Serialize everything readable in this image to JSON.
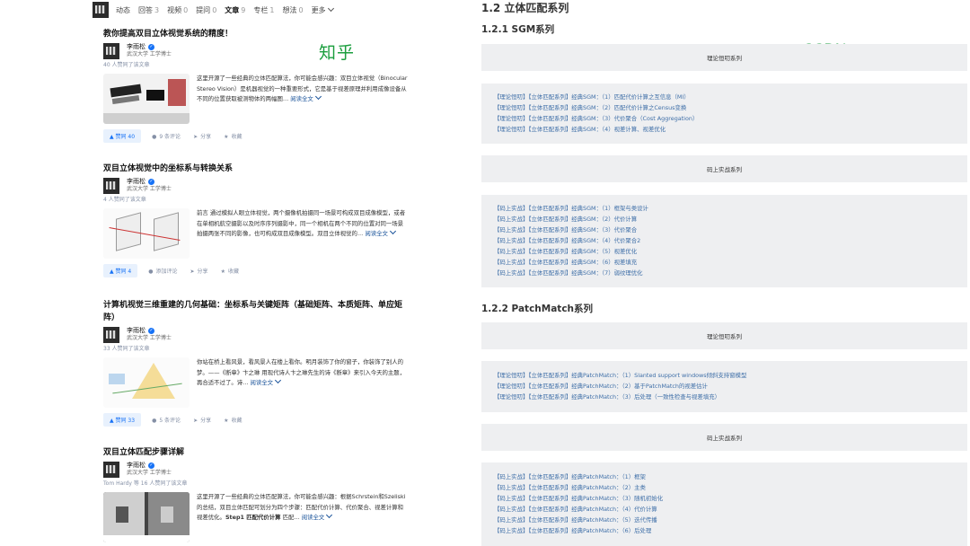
{
  "zhihu": {
    "logo_text": "知乎",
    "tabs": [
      {
        "label": "动态",
        "count": ""
      },
      {
        "label": "回答",
        "count": "3"
      },
      {
        "label": "视频",
        "count": "0"
      },
      {
        "label": "提问",
        "count": "0"
      },
      {
        "label": "文章",
        "count": "9"
      },
      {
        "label": "专栏",
        "count": "1"
      },
      {
        "label": "想法",
        "count": "0"
      },
      {
        "label": "更多",
        "count": ""
      }
    ],
    "articles": [
      {
        "title": "教你提高双目立体视觉系统的精度！",
        "author": "李雨松",
        "author_desc": "武汉大学 工学博士",
        "votes_text": "40 人赞同了该文章",
        "excerpt": "这里开源了一些经典的立体匹配算法，你可能会感兴趣：双目立体视觉（Binocular Stereo Vision）是机器视觉的一种重要形式，它是基于视差原理并利用成像设备从不同的位置获取被测物体的两幅图…",
        "read_more": "阅读全文",
        "vote_label": "▲ 赞同 40",
        "comment_label": "9 条评论",
        "share_label": "分享",
        "fav_label": "收藏"
      },
      {
        "title": "双目立体视觉中的坐标系与转换关系",
        "author": "李雨松",
        "author_desc": "武汉大学 工学博士",
        "votes_text": "4 人赞同了该文章",
        "excerpt": "前言 通过模拟人眼立体视觉，两个摄像机拍摄同一场景可构成双目成像模型，或者在单相机航空摄影以及时序序列摄影中，同一个相机在两个不同的位置对同一场景拍摄两张不同的影像，也可构成双目成像模型。双目立体视觉的…",
        "read_more": "阅读全文",
        "vote_label": "▲ 赞同 4",
        "comment_label": "添加评论",
        "share_label": "分享",
        "fav_label": "收藏"
      },
      {
        "title": "计算机视觉三维重建的几何基础：坐标系与关键矩阵（基础矩阵、本质矩阵、单应矩阵）",
        "author": "李雨松",
        "author_desc": "武汉大学 工学博士",
        "votes_text": "33 人赞同了该文章",
        "excerpt": "你站在桥上看风景，看风景人在楼上看你。明月装饰了你的窗子，你装饰了别人的梦。——《断章》卞之琳 用现代诗人卞之琳先生的诗《断章》来引入今天的主题，再合适不过了。诗…",
        "read_more": "阅读全文",
        "vote_label": "▲ 赞同 33",
        "comment_label": "5 条评论",
        "share_label": "分享",
        "fav_label": "收藏"
      },
      {
        "title": "双目立体匹配步骤详解",
        "author": "李雨松",
        "author_desc": "武汉大学 工学博士",
        "votes_text": "Tom Hardy 等 16 人赞同了该文章",
        "excerpt": "这里开源了一些经典的立体匹配算法，你可能会感兴趣：根据Schrstein和Szeliski的总结，双目立体匹配可划分为四个步骤：匹配代价计算、代价聚合、视差计算和视差优化。",
        "excerpt_bold": "Step1 匹配代价计算",
        "excerpt_tail": " 匹配…",
        "read_more": "阅读全文"
      }
    ]
  },
  "csdn": {
    "logo_text": "CSDN",
    "heading_main": "1.2 立体匹配系列",
    "heading_sgm": "1.2.1 SGM系列",
    "heading_pm": "1.2.2 PatchMatch系列",
    "band_theory": "理论恒叨系列",
    "band_code": "码上实战系列",
    "sgm_theory": [
      "【理论恒叨】【立体匹配系列】经典SGM：（1）匹配代价计算之互信息（MI）",
      "【理论恒叨】【立体匹配系列】经典SGM：（2）匹配代价计算之Census变换",
      "【理论恒叨】【立体匹配系列】经典SGM：（3）代价聚合（Cost Aggregation）",
      "【理论恒叨】【立体匹配系列】经典SGM：（4）视差计算、视差优化"
    ],
    "sgm_code": [
      "【码上实战】【立体匹配系列】经典SGM：（1）框架与类设计",
      "【码上实战】【立体匹配系列】经典SGM：（2）代价计算",
      "【码上实战】【立体匹配系列】经典SGM：（3）代价聚合",
      "【码上实战】【立体匹配系列】经典SGM：（4）代价聚合2",
      "【码上实战】【立体匹配系列】经典SGM：（5）视差优化",
      "【码上实战】【立体匹配系列】经典SGM：（6）视差填充",
      "【码上实战】【立体匹配系列】经典SGM：（7）弱纹理优化"
    ],
    "pm_theory": [
      "【理论恒叨】【立体匹配系列】经典PatchMatch：（1）Slanted support windows倾斜支持窗模型",
      "【理论恒叨】【立体匹配系列】经典PatchMatch：（2）基于PatchMatch的视差估计",
      "【理论恒叨】【立体匹配系列】经典PatchMatch：（3）后处理（一致性检查与视差填充）"
    ],
    "pm_code": [
      "【码上实战】【立体匹配系列】经典PatchMatch：（1）框架",
      "【码上实战】【立体匹配系列】经典PatchMatch：（2）主类",
      "【码上实战】【立体匹配系列】经典PatchMatch：（3）随机初始化",
      "【码上实战】【立体匹配系列】经典PatchMatch：（4）代价计算",
      "【码上实战】【立体匹配系列】经典PatchMatch：（5）迭代传播",
      "【码上实战】【立体匹配系列】经典PatchMatch：（6）后处理"
    ]
  }
}
